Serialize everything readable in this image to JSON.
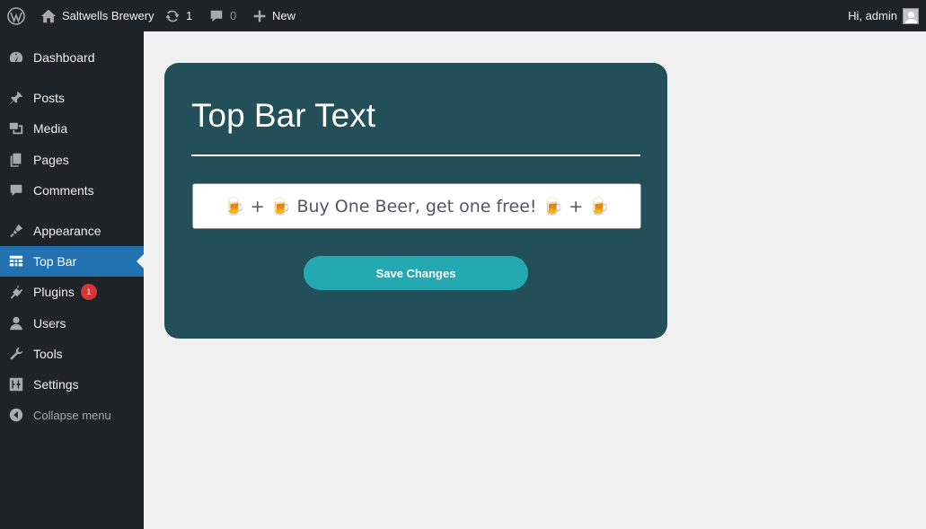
{
  "admin_bar": {
    "wp_icon": "wordpress-logo-icon",
    "site_name": "Saltwells Brewery",
    "updates_count": "1",
    "comments_count": "0",
    "new_label": "New",
    "greeting": "Hi, admin"
  },
  "sidebar": {
    "items": [
      {
        "label": "Dashboard",
        "icon": "dashboard-icon"
      },
      {
        "label": "Posts",
        "icon": "pushpin-icon"
      },
      {
        "label": "Media",
        "icon": "media-icon"
      },
      {
        "label": "Pages",
        "icon": "pages-icon"
      },
      {
        "label": "Comments",
        "icon": "comment-icon"
      },
      {
        "label": "Appearance",
        "icon": "paintbrush-icon"
      },
      {
        "label": "Top Bar",
        "icon": "table-icon"
      },
      {
        "label": "Plugins",
        "icon": "plugin-icon",
        "badge": "1"
      },
      {
        "label": "Users",
        "icon": "user-icon"
      },
      {
        "label": "Tools",
        "icon": "wrench-icon"
      },
      {
        "label": "Settings",
        "icon": "settings-icon"
      }
    ],
    "collapse_label": "Collapse menu",
    "current": "Top Bar"
  },
  "main": {
    "title": "Top Bar Text",
    "top_bar_text_value": "🍺 + 🍺 Buy One Beer, get one free! 🍺 + 🍺",
    "save_label": "Save Changes"
  },
  "colors": {
    "admin_dark": "#1d2327",
    "current_blue": "#2271b1",
    "card_bg": "#234f58",
    "button_teal": "#24a9b3",
    "badge_red": "#d63638"
  }
}
